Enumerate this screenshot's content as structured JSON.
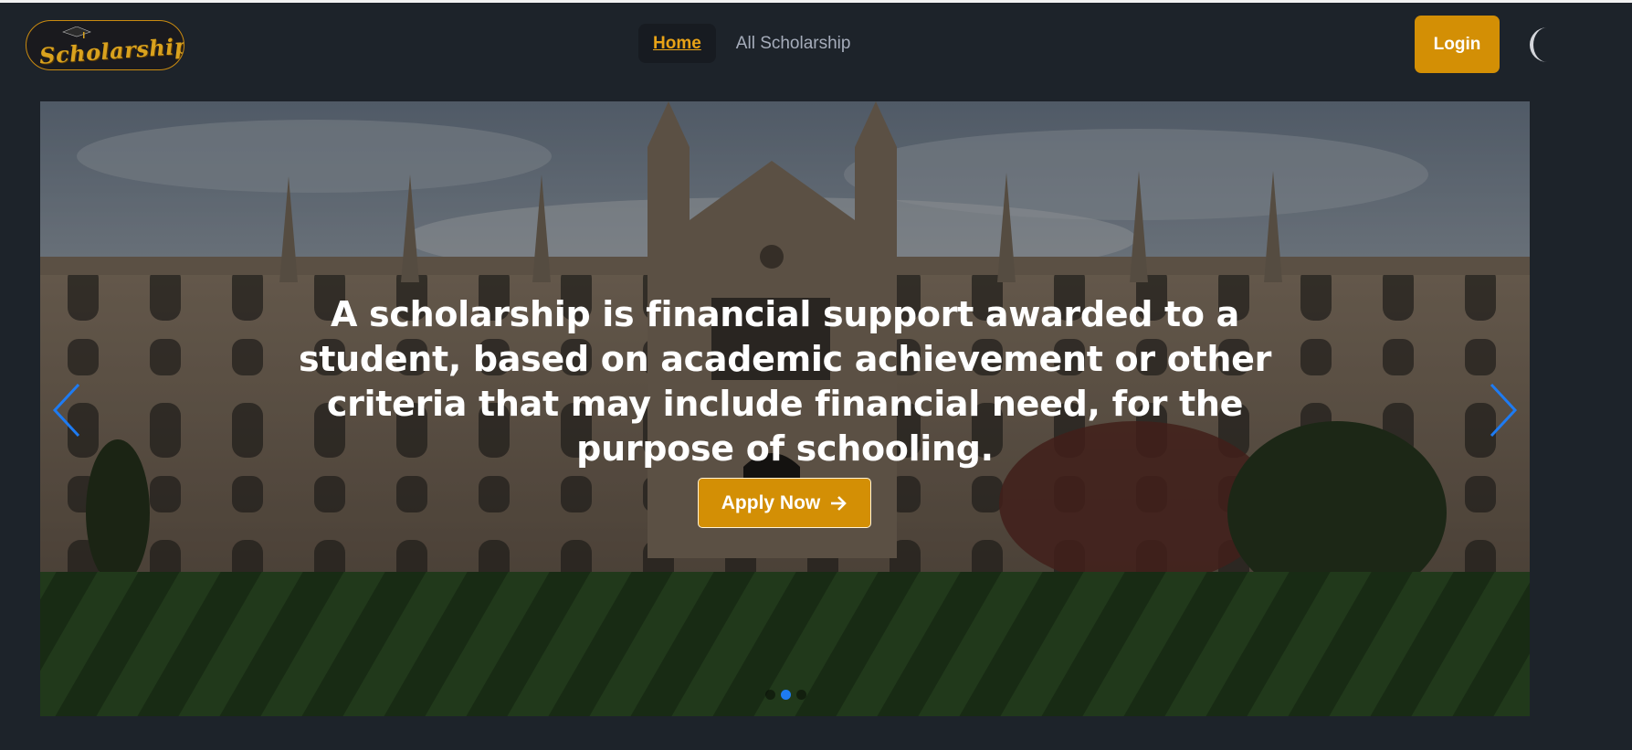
{
  "brand": {
    "logo_text": "Scholarship"
  },
  "nav": {
    "items": [
      {
        "label": "Home",
        "active": true
      },
      {
        "label": "All Scholarship",
        "active": false
      }
    ]
  },
  "header": {
    "login_label": "Login",
    "theme_icon": "moon-icon"
  },
  "hero": {
    "headline": "A scholarship is financial support awarded to a student, based on academic achievement or other criteria that may include financial need, for the purpose of schooling.",
    "cta_label": "Apply Now",
    "cta_icon": "arrow-right-icon",
    "prev_icon": "chevron-left-icon",
    "next_icon": "chevron-right-icon",
    "slides_total": 3,
    "active_slide": 2
  },
  "colors": {
    "accent": "#d38f05",
    "nav_active": "#e8a317",
    "background": "#1d232a",
    "carousel_arrow": "#1e7bf2"
  }
}
